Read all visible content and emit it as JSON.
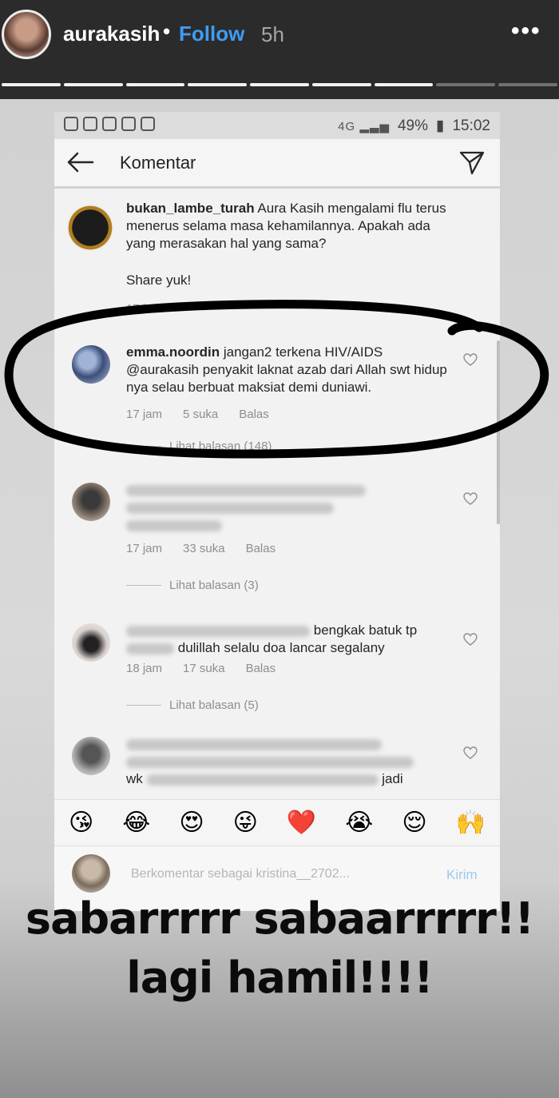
{
  "story": {
    "username": "aurakasih",
    "separator": "•",
    "follow_label": "Follow",
    "time": "5h",
    "more_label": "•••",
    "progress_segments": [
      1,
      1,
      1,
      1,
      1,
      1,
      0.9,
      0,
      0
    ]
  },
  "statusbar": {
    "battery": "49%",
    "clock": "15:02"
  },
  "appbar": {
    "title": "Komentar"
  },
  "caption_comment": {
    "username": "bukan_lambe_turah",
    "text": "Aura Kasih mengalami flu terus menerus selama masa kehamilannya. Apakah ada yang merasakan hal yang sama?",
    "text2": "Share yuk!",
    "time": "17 jam"
  },
  "comments": [
    {
      "username": "emma.noordin",
      "text": "jangan2 terkena HIV/AIDS @aurakasih penyakit laknat azab dari Allah swt hidup nya selau berbuat maksiat demi duniawi.",
      "time": "17 jam",
      "likes": "5 suka",
      "reply_label": "Balas",
      "view_replies": "Lihat balasan (148)"
    },
    {
      "username": "",
      "text": "",
      "time": "17 jam",
      "likes": "33 suka",
      "reply_label": "Balas",
      "view_replies": "Lihat balasan (3)"
    },
    {
      "username": "",
      "text_visible_1": "bengkak batuk tp",
      "text_visible_2": "dulillah selalu doa lancar segalany",
      "time": "18 jam",
      "likes": "17 suka",
      "reply_label": "Balas",
      "view_replies": "Lihat balasan (5)"
    },
    {
      "username": "",
      "text_visible_1": "wk",
      "text_visible_2": "jadi"
    }
  ],
  "emoji_bar": [
    "😘",
    "😂",
    "😍",
    "😜",
    "❤️",
    "😭",
    "😌",
    "🙌"
  ],
  "input": {
    "placeholder": "Berkomentar sebagai kristina__2702...",
    "send_label": "Kirim"
  },
  "overlay_text": {
    "line1": "sabarrrrr sabaarrrrr!!",
    "line2": "lagi hamil!!!!"
  }
}
